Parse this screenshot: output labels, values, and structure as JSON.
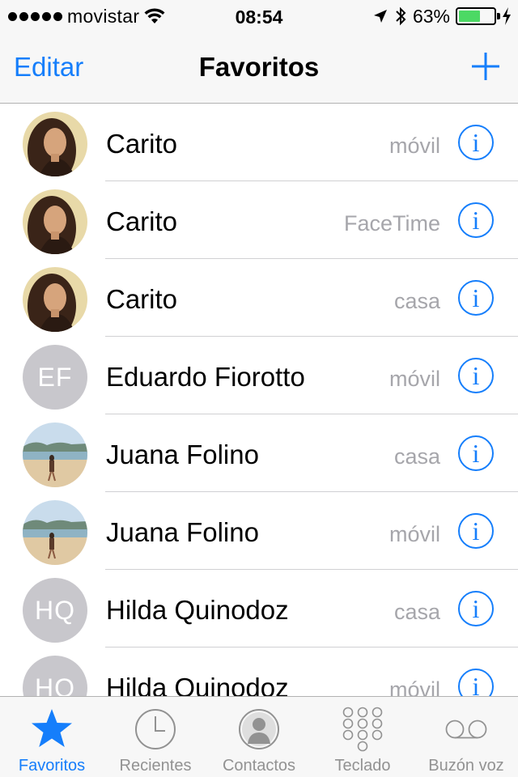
{
  "status": {
    "carrier": "movistar",
    "time": "08:54",
    "battery_text": "63%",
    "battery_level": 0.63,
    "icons": [
      "signal-dots-icon",
      "wifi-icon",
      "location-arrow-icon",
      "bluetooth-icon",
      "battery-icon",
      "charging-bolt-icon"
    ]
  },
  "nav": {
    "edit_label": "Editar",
    "title": "Favoritos",
    "add_icon": "plus-icon"
  },
  "favorites": [
    {
      "name": "Carito",
      "type": "móvil",
      "avatar": "photo"
    },
    {
      "name": "Carito",
      "type": "FaceTime",
      "avatar": "photo"
    },
    {
      "name": "Carito",
      "type": "casa",
      "avatar": "photo"
    },
    {
      "name": "Eduardo Fiorotto",
      "type": "móvil",
      "avatar": "initials",
      "initials": "EF"
    },
    {
      "name": "Juana Folino",
      "type": "casa",
      "avatar": "photo-beach"
    },
    {
      "name": "Juana Folino",
      "type": "móvil",
      "avatar": "photo-beach"
    },
    {
      "name": "Hilda Quinodoz",
      "type": "casa",
      "avatar": "initials",
      "initials": "HQ"
    },
    {
      "name": "Hilda Quinodoz",
      "type": "móvil",
      "avatar": "initials",
      "initials": "HQ"
    }
  ],
  "info_glyph": "i",
  "tabs": [
    {
      "label": "Favoritos",
      "icon": "star-icon",
      "active": true
    },
    {
      "label": "Recientes",
      "icon": "clock-icon",
      "active": false
    },
    {
      "label": "Contactos",
      "icon": "contact-silhouette-icon",
      "active": false
    },
    {
      "label": "Teclado",
      "icon": "keypad-icon",
      "active": false
    },
    {
      "label": "Buzón voz",
      "icon": "voicemail-icon",
      "active": false
    }
  ],
  "colors": {
    "accent": "#157efb",
    "secondary_text": "#a6a6ab",
    "avatar_gray": "#c8c7cc",
    "battery_green": "#4cd964",
    "inactive_tab": "#929292"
  }
}
